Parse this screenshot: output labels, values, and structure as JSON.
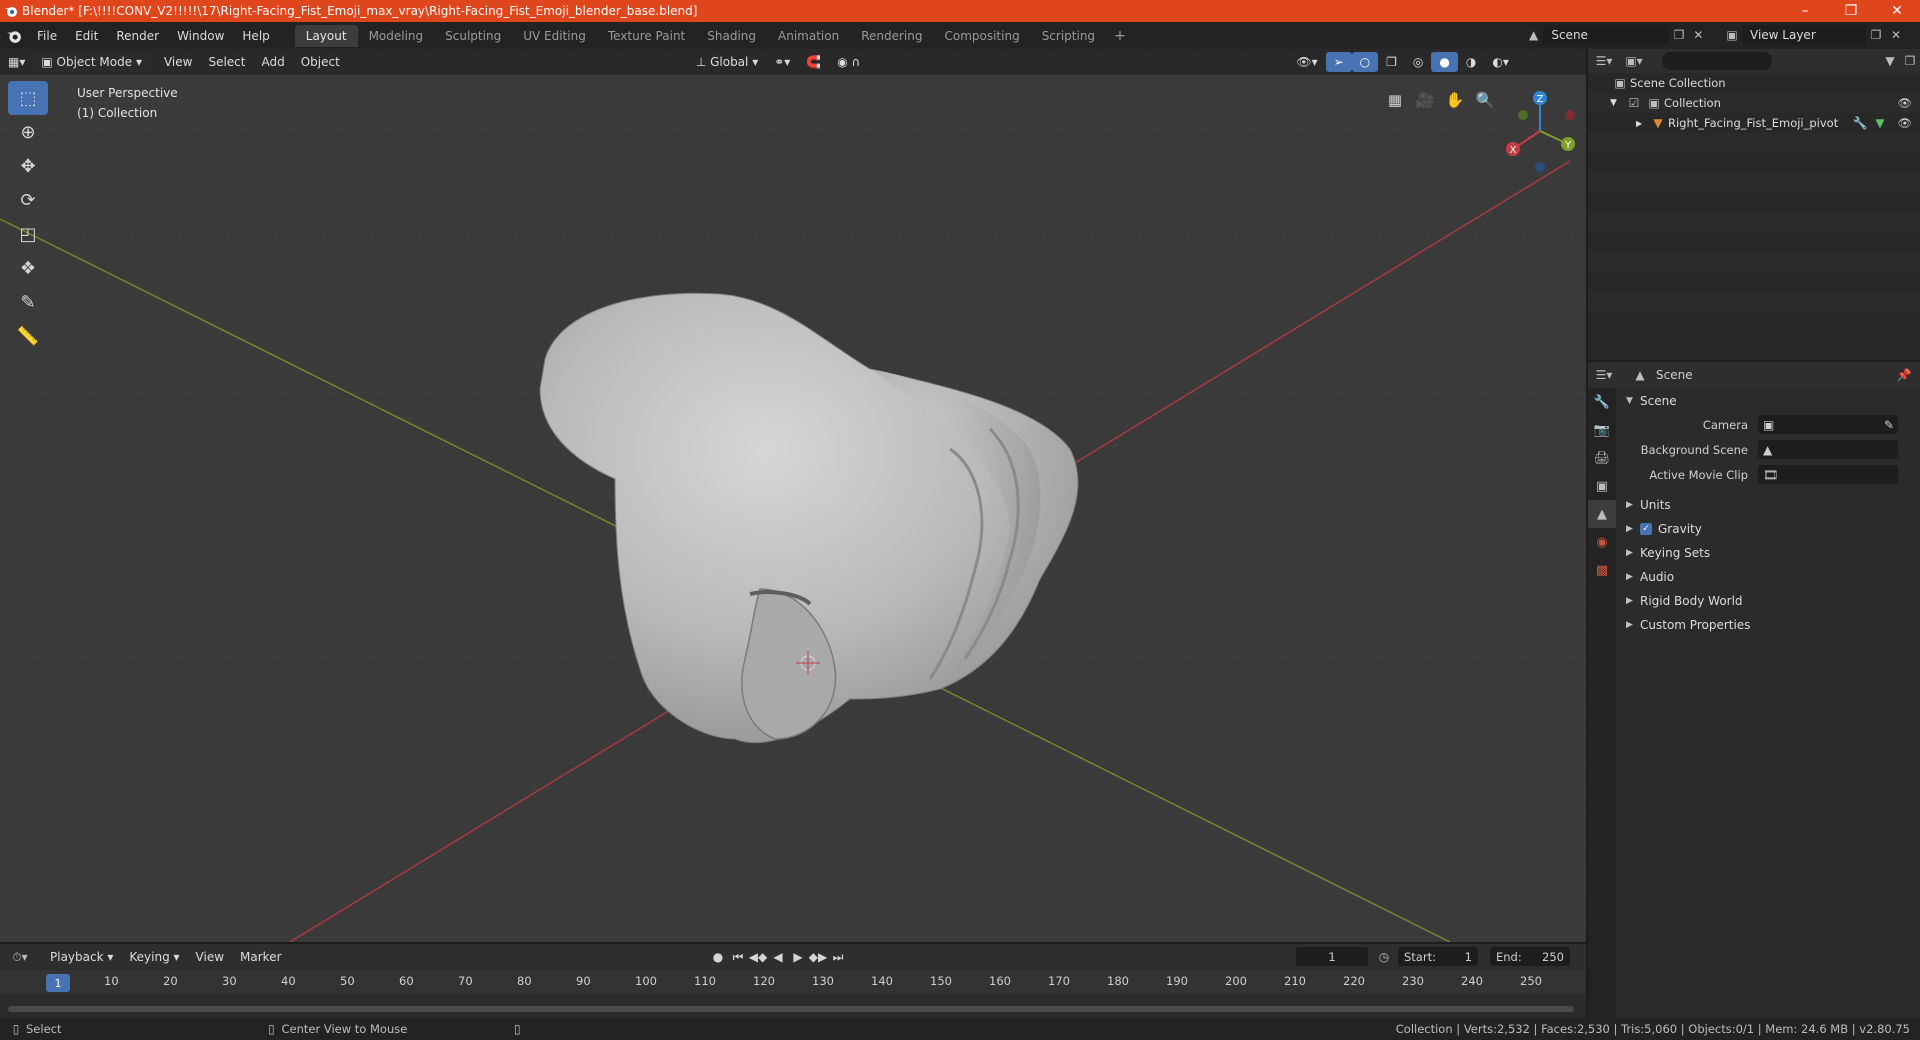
{
  "window": {
    "title": "Blender* [F:\\!!!!CONV_V2!!!!!\\17\\Right-Facing_Fist_Emoji_max_vray\\Right-Facing_Fist_Emoji_blender_base.blend]"
  },
  "menu": {
    "items": [
      "File",
      "Edit",
      "Render",
      "Window",
      "Help"
    ]
  },
  "workspaces": {
    "tabs": [
      "Layout",
      "Modeling",
      "Sculpting",
      "UV Editing",
      "Texture Paint",
      "Shading",
      "Animation",
      "Rendering",
      "Compositing",
      "Scripting"
    ],
    "active": "Layout",
    "add": "+"
  },
  "scene": {
    "name": "Scene"
  },
  "view_layer": {
    "name": "View Layer"
  },
  "viewport": {
    "mode": "Object Mode",
    "menus": [
      "View",
      "Select",
      "Add",
      "Object"
    ],
    "transform": "Global",
    "perspective": "User Perspective",
    "collection": "(1) Collection",
    "gizmo": {
      "z": "Z",
      "y": "Y",
      "x": "X"
    }
  },
  "outliner": {
    "root": "Scene Collection",
    "collection": "Collection",
    "object": "Right_Facing_Fist_Emoji_pivot"
  },
  "properties": {
    "header": "Scene",
    "panel": "Scene",
    "rows": [
      {
        "label": "Camera",
        "value": ""
      },
      {
        "label": "Background Scene",
        "value": ""
      },
      {
        "label": "Active Movie Clip",
        "value": ""
      }
    ],
    "subpanels": [
      "Units",
      "Gravity",
      "Keying Sets",
      "Audio",
      "Rigid Body World",
      "Custom Properties"
    ]
  },
  "timeline": {
    "menus": [
      "Playback",
      "Keying",
      "View",
      "Marker"
    ],
    "current_frame": "1",
    "start_label": "Start:",
    "start": "1",
    "end_label": "End:",
    "end": "250",
    "ticks": [
      "10",
      "20",
      "30",
      "40",
      "50",
      "60",
      "70",
      "80",
      "90",
      "100",
      "110",
      "120",
      "130",
      "140",
      "150",
      "160",
      "170",
      "180",
      "190",
      "200",
      "210",
      "220",
      "230",
      "240",
      "250"
    ],
    "playhead": "1"
  },
  "status": {
    "left1": "Select",
    "left2": "Center View to Mouse",
    "right": "Collection | Verts:2,532 | Faces:2,530 | Tris:5,060 | Objects:0/1 | Mem: 24.6 MB | v2.80.75"
  },
  "colors": {
    "titlebar": "#e0461c",
    "accent": "#4772b3",
    "x_axis": "#c83c45",
    "y_axis": "#7fa02a",
    "z_axis": "#2f86d6"
  }
}
